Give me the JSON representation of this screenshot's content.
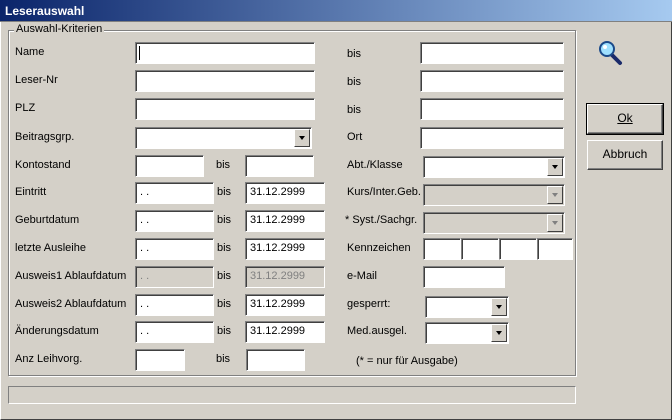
{
  "window": {
    "title": "Leserauswahl"
  },
  "group": {
    "legend": "Auswahl-Kriterien"
  },
  "left": {
    "name_label": "Name",
    "leser_nr_label": "Leser-Nr",
    "plz_label": "PLZ",
    "beitragsgrp_label": "Beitragsgrp.",
    "kontostand_label": "Kontostand",
    "eintritt_label": "Eintritt",
    "geburtdatum_label": "Geburtdatum",
    "letzte_ausleihe_label": "letzte Ausleihe",
    "ausweis1_label": "Ausweis1 Ablaufdatum",
    "ausweis2_label": "Ausweis2  Ablaufdatum",
    "aenderungsdatum_label": "Änderungsdatum",
    "anz_leihvorg_label": "Anz Leihvorg.",
    "bis_label": "bis",
    "date_placeholder": " .  .",
    "date_until": "31.12.2999"
  },
  "right": {
    "bis_label": "bis",
    "ort_label": "Ort",
    "abt_klasse_label": "Abt./Klasse",
    "kurs_label": "Kurs/Inter.Geb.",
    "syst_label": "* Syst./Sachgr.",
    "kennzeichen_label": "Kennzeichen",
    "email_label": "e-Mail",
    "gesperrt_label": "gesperrt:",
    "med_ausgel_label": "Med.ausgel.",
    "note": "(* = nur für Ausgabe)"
  },
  "buttons": {
    "ok": "Ok",
    "abbruch": "Abbruch"
  },
  "icons": {
    "search": "search-icon"
  }
}
